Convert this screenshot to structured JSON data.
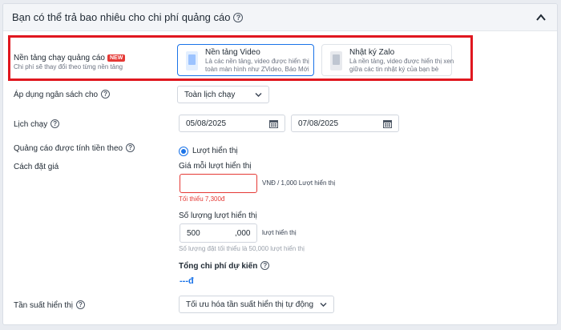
{
  "header": {
    "title": "Bạn có thể trả bao nhiêu cho chi phí quảng cáo",
    "help_glyph": "?",
    "collapse_icon": "chevron-up-icon"
  },
  "platform": {
    "label": "Nền tảng chạy quảng cáo",
    "badge": "NEW",
    "sublabel": "Chi phí sẽ thay đổi theo từng nền tảng",
    "options": [
      {
        "title": "Nền tảng Video",
        "desc": "Là các nền tảng, video được hiển thị toàn màn hình như ZVideo, Báo Mới",
        "selected": true,
        "icon": "video-phone-icon"
      },
      {
        "title": "Nhật ký Zalo",
        "desc": "Là nền tảng, video được hiển thị xen giữa các tin nhật ký của bạn bè",
        "selected": false,
        "icon": "feed-phone-icon"
      }
    ]
  },
  "budget_apply": {
    "label": "Áp dụng ngân sách cho",
    "value": "Toàn lịch chạy"
  },
  "schedule": {
    "label": "Lịch chạy",
    "start": "05/08/2025",
    "end": "07/08/2025"
  },
  "billing": {
    "label": "Quảng cáo được tính tiền theo",
    "option": "Lượt hiển thị"
  },
  "bid": {
    "label": "Cách đặt giá",
    "price_label": "Giá mỗi lượt hiển thị",
    "price_value": "",
    "price_unit": "VNĐ / 1,000 Lượt hiển thị",
    "price_error": "Tối thiểu 7,300đ",
    "qty_label": "Số lượng lượt hiển thị",
    "qty_value": "500",
    "qty_suffix": ",000",
    "qty_unit": "lượt hiển thị",
    "qty_hint": "Số lượng đặt tối thiểu là 50,000 lượt hiển thị",
    "total_label": "Tổng chi phí dự kiến",
    "total_value": "---đ"
  },
  "frequency": {
    "label": "Tần suất hiển thị",
    "value": "Tối ưu hóa tần suất hiển thị tự động"
  },
  "colors": {
    "accent": "#1a73e8",
    "error": "#e53935",
    "highlight": "#e0171f"
  }
}
